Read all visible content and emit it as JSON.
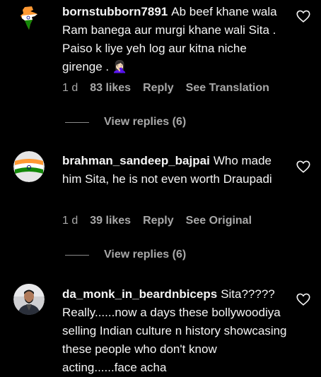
{
  "comments": [
    {
      "username": "bornstubborn7891",
      "text": "Ab beef khane wala Ram banega aur murgi khane wali Sita . Paiso k liye yeh log aur kitna niche girenge .",
      "emoji": "🤦🏻‍♀️",
      "time": "1 d",
      "likes": "83 likes",
      "reply": "Reply",
      "translation": "See Translation",
      "view_replies": "View replies (6)"
    },
    {
      "username": "brahman_sandeep_bajpai",
      "text": "Who made him Sita, he is not even worth Draupadi",
      "time": "1 d",
      "likes": "39 likes",
      "reply": "Reply",
      "translation": "See Original",
      "view_replies": "View replies (6)"
    },
    {
      "username": "da_monk_in_beardnbiceps",
      "text": "Sita????? Really......now a days these bollywoodiya selling Indian culture n history showcasing these people who don't know acting......face acha"
    }
  ],
  "colors": {
    "background": "#000000",
    "text": "#f5f5f5",
    "secondary": "#a8a8a8"
  }
}
